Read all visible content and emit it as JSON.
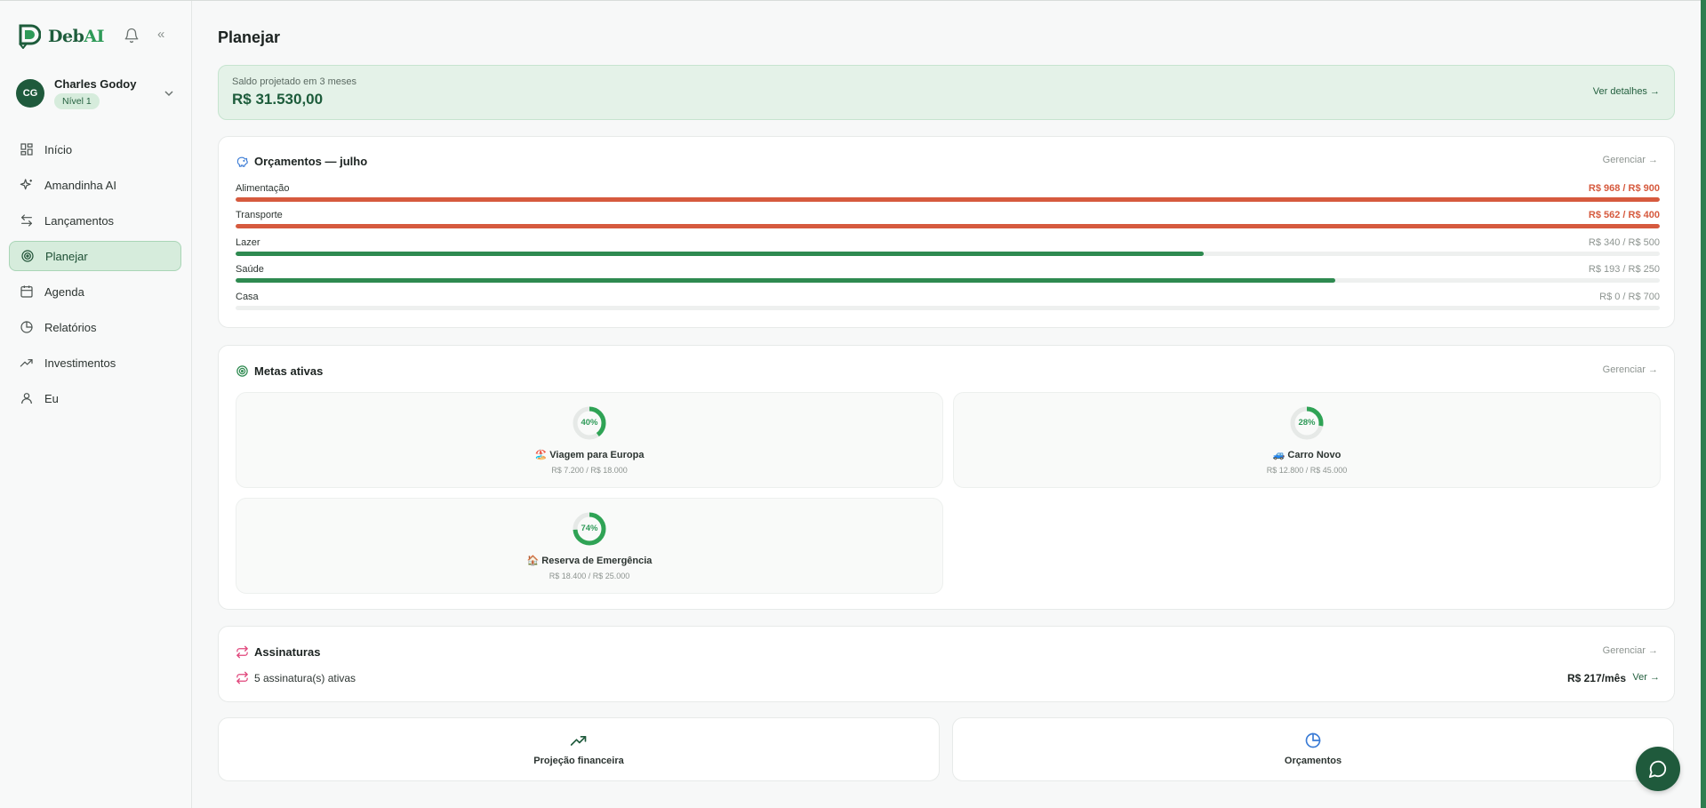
{
  "brand": {
    "name_main": "Deb",
    "name_ai": "AI"
  },
  "user": {
    "initials": "CG",
    "name": "Charles Godoy",
    "level": "Nível 1"
  },
  "nav": {
    "items": [
      {
        "label": "Início",
        "icon": "grid-icon"
      },
      {
        "label": "Amandinha AI",
        "icon": "sparkles-icon"
      },
      {
        "label": "Lançamentos",
        "icon": "arrows-swap-icon"
      },
      {
        "label": "Planejar",
        "icon": "target-icon",
        "active": true
      },
      {
        "label": "Agenda",
        "icon": "calendar-icon"
      },
      {
        "label": "Relatórios",
        "icon": "pie-chart-icon"
      },
      {
        "label": "Investimentos",
        "icon": "trending-up-icon"
      },
      {
        "label": "Eu",
        "icon": "user-icon"
      }
    ]
  },
  "page": {
    "title": "Planejar"
  },
  "saldo": {
    "label": "Saldo projetado em 3 meses",
    "value": "R$ 31.530,00",
    "link": "Ver detalhes →"
  },
  "budgets": {
    "title": "Orçamentos — julho",
    "manage": "Gerenciar →",
    "items": [
      {
        "name": "Alimentação",
        "amount": "R$ 968 / R$ 900",
        "progress": 1.0,
        "over": true
      },
      {
        "name": "Transporte",
        "amount": "R$ 562 / R$ 400",
        "progress": 1.0,
        "over": true
      },
      {
        "name": "Lazer",
        "amount": "R$ 340 / R$ 500",
        "progress": 0.68,
        "over": false
      },
      {
        "name": "Saúde",
        "amount": "R$ 193 / R$ 250",
        "progress": 0.772,
        "over": false
      },
      {
        "name": "Casa",
        "amount": "R$ 0 / R$ 700",
        "progress": 0,
        "over": false
      }
    ]
  },
  "goals": {
    "title": "Metas ativas",
    "manage": "Gerenciar →",
    "items": [
      {
        "pct_label": "40%",
        "progress": 0.4,
        "name": "🏖️ Viagem para Europa",
        "amount": "R$ 7.200 / R$ 18.000"
      },
      {
        "pct_label": "28%",
        "progress": 0.28,
        "name": "🚙 Carro Novo",
        "amount": "R$ 12.800 / R$ 45.000"
      },
      {
        "pct_label": "74%",
        "progress": 0.74,
        "name": "🏠 Reserva de Emergência",
        "amount": "R$ 18.400 / R$ 25.000"
      }
    ]
  },
  "subscriptions": {
    "title": "Assinaturas",
    "manage": "Gerenciar →",
    "count": "5 assinatura(s) ativas",
    "value": "R$ 217/mês",
    "link": "Ver →"
  },
  "shortcuts": [
    {
      "label": "Projeção financeira",
      "icon": "trending-up-icon"
    },
    {
      "label": "Orçamentos",
      "icon": "pie-chart-icon"
    }
  ],
  "colors": {
    "accent": "#1f5a3c",
    "success": "#2e8a50",
    "danger": "#d65a3e",
    "pink": "#e0457b",
    "blue": "#3a7bd5"
  }
}
